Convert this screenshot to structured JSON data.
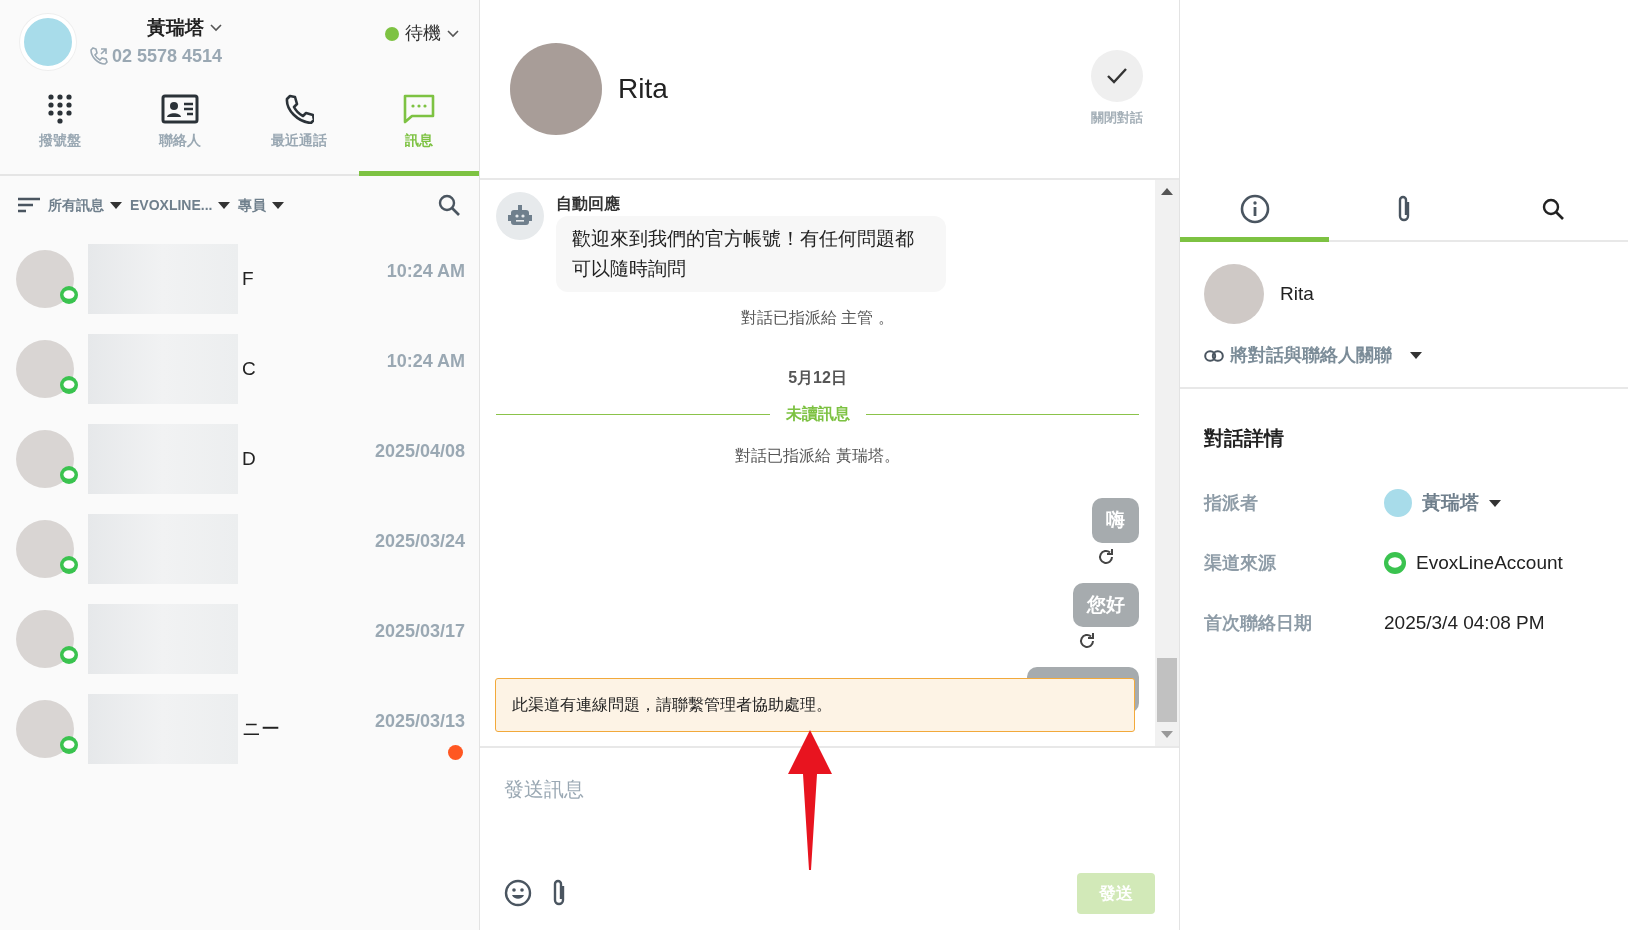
{
  "agent": {
    "name": "黃瑞塔",
    "phone": "02 5578 4514",
    "status": "待機"
  },
  "nav_tabs": [
    {
      "label": "撥號盤",
      "kind": "dialpad",
      "selected": false
    },
    {
      "label": "聯絡人",
      "kind": "contacts",
      "selected": false
    },
    {
      "label": "最近通話",
      "kind": "calls",
      "selected": false
    },
    {
      "label": "訊息",
      "kind": "messages",
      "selected": true
    }
  ],
  "filters": [
    {
      "label": "所有訊息"
    },
    {
      "label": "EVOXLINE..."
    },
    {
      "label": "專員"
    }
  ],
  "conversations": [
    {
      "name": "F",
      "time": "10:24 AM",
      "unread": false
    },
    {
      "name": "C",
      "time": "10:24 AM",
      "unread": false
    },
    {
      "name": "D",
      "time": "2025/04/08",
      "unread": false
    },
    {
      "time": "2025/03/24",
      "unread": false
    },
    {
      "time": "2025/03/17",
      "unread": false
    },
    {
      "name": "ニー",
      "time": "2025/03/13",
      "unread": true
    }
  ],
  "chat": {
    "contact_name": "Rita",
    "close_label": "關閉對話",
    "messages": [
      {
        "kind": "bot",
        "sender": "自動回應",
        "text": "歡迎來到我們的官方帳號！有任何問題都可以隨時詢問"
      },
      {
        "kind": "system",
        "text": "對話已指派給 主管 。"
      },
      {
        "kind": "date",
        "text": "5月12日"
      },
      {
        "kind": "divider",
        "text": "未讀訊息"
      },
      {
        "kind": "system",
        "text": "對話已指派給 黃瑞塔。"
      },
      {
        "kind": "outgoing",
        "text": "嗨",
        "failed": true
      },
      {
        "kind": "outgoing",
        "text": "您好",
        "failed": true
      },
      {
        "kind": "covered"
      }
    ],
    "alert": "此渠道有連線問題，請聯繫管理者協助處理。",
    "composer": {
      "placeholder": "發送訊息",
      "send_label": "發送",
      "send_disabled": true
    }
  },
  "details": {
    "tabs": [
      {
        "kind": "info",
        "selected": true
      },
      {
        "kind": "attachment",
        "selected": false
      },
      {
        "kind": "search",
        "selected": false
      }
    ],
    "contact_name": "Rita",
    "link_label": "將對話與聯絡人關聯",
    "title": "對話詳情",
    "rows": [
      {
        "label": "指派者",
        "value": "黃瑞塔",
        "kind": "assignee"
      },
      {
        "label": "渠道來源",
        "value": "EvoxLineAccount",
        "kind": "channel"
      },
      {
        "label": "首次聯絡日期",
        "value": "2025/3/4 04:08 PM",
        "kind": "text"
      }
    ]
  },
  "annotation": {
    "kind": "arrow"
  }
}
